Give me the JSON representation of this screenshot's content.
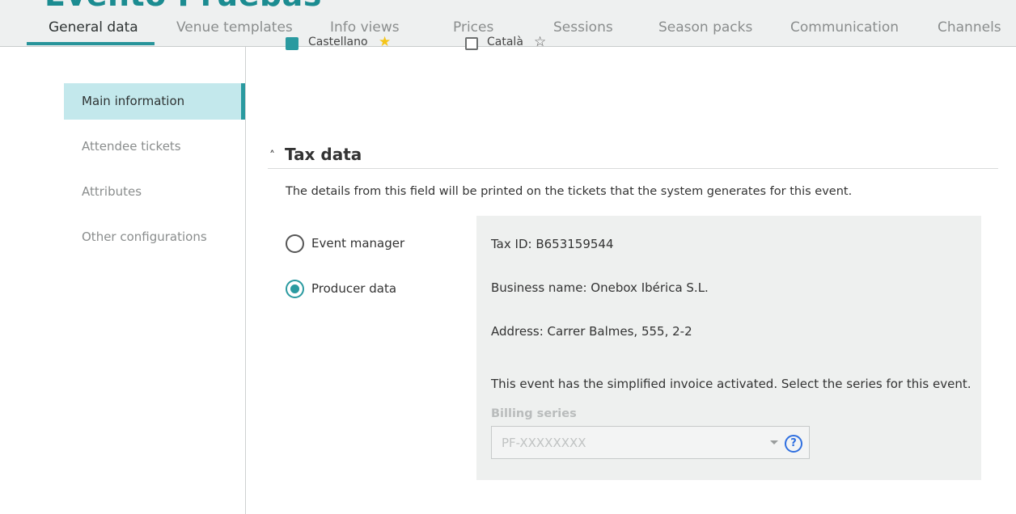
{
  "header": {
    "title": "Evento Pruebas",
    "tabs": [
      {
        "label": "General data",
        "active": true
      },
      {
        "label": "Venue templates"
      },
      {
        "label": "Info views"
      },
      {
        "label": "Prices"
      },
      {
        "label": "Sessions"
      },
      {
        "label": "Season packs"
      },
      {
        "label": "Communication"
      },
      {
        "label": "Channels"
      }
    ]
  },
  "sidebar": {
    "items": [
      {
        "label": "Main information",
        "active": true
      },
      {
        "label": "Attendee tickets"
      },
      {
        "label": "Attributes"
      },
      {
        "label": "Other configurations"
      }
    ]
  },
  "top_row": {
    "left": {
      "label": "Castellano",
      "checked": true,
      "star": "filled-star-icon"
    },
    "right": {
      "label": "Català",
      "checked": false,
      "star": "outline-star-icon"
    }
  },
  "tax_section": {
    "title": "Tax data",
    "description": "The details from this field will be printed on the tickets that the system generates for this event.",
    "options": [
      {
        "label": "Event manager",
        "selected": false
      },
      {
        "label": "Producer data",
        "selected": true
      }
    ],
    "producer": {
      "tax_id": "Tax ID: B653159544",
      "business_name": "Business name: Onebox Ibérica S.L.",
      "address": "Address: Carrer Balmes, 555, 2-2",
      "invoice_note": "This event has the simplified invoice activated. Select the series for this event.",
      "billing_label": "Billing series",
      "billing_placeholder": "PF-XXXXXXXX"
    }
  },
  "colors": {
    "accent": "#2a9aa0",
    "active_bg": "#c3e8ec",
    "star": "#f5c518",
    "help": "#2f6fe0"
  }
}
